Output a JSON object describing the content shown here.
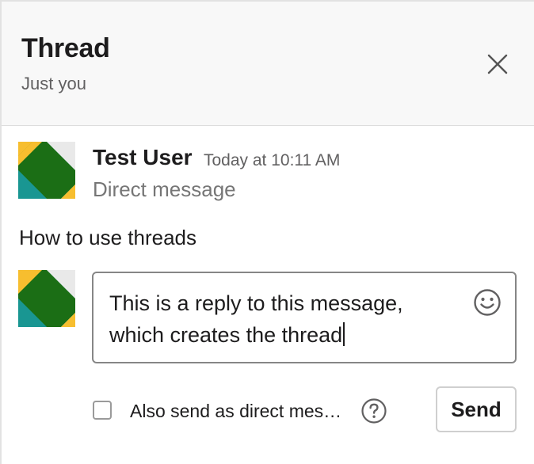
{
  "header": {
    "title": "Thread",
    "subtitle": "Just you",
    "close_icon": "close-icon"
  },
  "message": {
    "sender": "Test User",
    "timestamp": "Today at 10:11 AM",
    "channel": "Direct message",
    "text": "How to use threads",
    "avatar_icon": "user-avatar"
  },
  "reply": {
    "value": "This is a reply to this message,\nwhich creates the thread",
    "emoji_icon": "smiley-icon",
    "avatar_icon": "user-avatar"
  },
  "footer": {
    "checkbox_label": "Also send as direct mes…",
    "checkbox_checked": false,
    "help_icon": "help-icon",
    "send_label": "Send"
  },
  "colors": {
    "avatar_yellow": "#f7be2f",
    "avatar_teal": "#199692",
    "avatar_green": "#1b6e15",
    "avatar_light": "#e9e9e9"
  }
}
